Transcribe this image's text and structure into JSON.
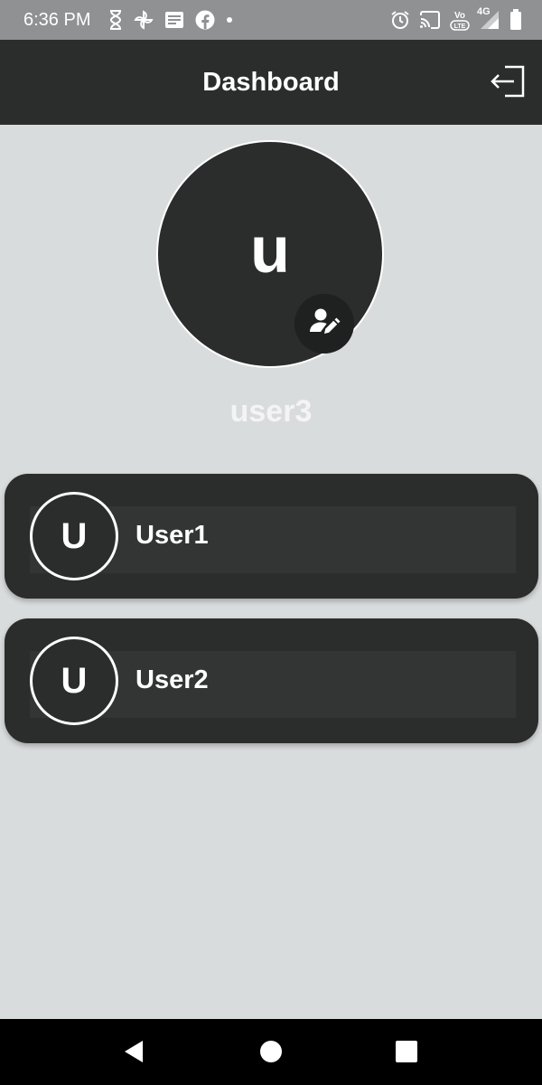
{
  "status_bar": {
    "time": "6:36 PM",
    "network_type": "4G",
    "left_icons": [
      "hourglass-icon",
      "pinwheel-icon",
      "news-icon",
      "facebook-icon",
      "dot-icon"
    ],
    "right_icons": [
      "alarm-icon",
      "cast-icon",
      "volte-icon",
      "signal-icon",
      "battery-icon"
    ]
  },
  "app_bar": {
    "title": "Dashboard",
    "logout_icon": "logout-icon"
  },
  "profile": {
    "initial": "u",
    "username": "user3",
    "edit_icon": "edit-user-icon"
  },
  "users": [
    {
      "initial": "U",
      "name": "User1"
    },
    {
      "initial": "U",
      "name": "User2"
    }
  ],
  "nav_bar": {
    "buttons": [
      "back-icon",
      "home-icon",
      "recents-icon"
    ]
  },
  "colors": {
    "background": "#d9dcdd",
    "app_bar": "#2b2c2c",
    "card": "#2b2c2c",
    "status_bar": "#8f9192",
    "text_light": "#ffffff"
  }
}
